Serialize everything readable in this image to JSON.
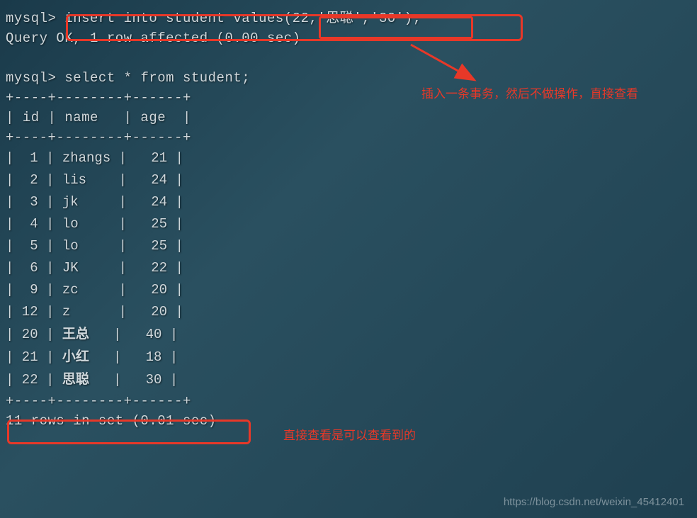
{
  "terminal": {
    "prompt": "mysql>",
    "cmd1": " insert into student values(22,'思聪','30');",
    "result1": "Query OK, 1 row affected (0.00 sec)",
    "cmd2": " select * from student;",
    "separator": "+----+--------+------+",
    "header": "| id | name   | age  |",
    "rows": [
      {
        "id": "1",
        "name": "zhangs",
        "age": "21"
      },
      {
        "id": "2",
        "name": "lis",
        "age": "24"
      },
      {
        "id": "3",
        "name": "jk",
        "age": "24"
      },
      {
        "id": "4",
        "name": "lo",
        "age": "25"
      },
      {
        "id": "5",
        "name": "lo",
        "age": "25"
      },
      {
        "id": "6",
        "name": "JK",
        "age": "22"
      },
      {
        "id": "9",
        "name": "zc",
        "age": "20"
      },
      {
        "id": "12",
        "name": "z",
        "age": "20"
      },
      {
        "id": "20",
        "name": "王总",
        "age": "40",
        "cjk": true
      },
      {
        "id": "21",
        "name": "小红",
        "age": "18",
        "cjk": true
      },
      {
        "id": "22",
        "name": "思聪",
        "age": "30",
        "cjk": true
      }
    ],
    "footer": "11 rows in set (0.01 sec)"
  },
  "annotations": {
    "a1": "插入一条事务，然后不做操作，直接查看",
    "a2": "直接查看是可以查看到的"
  },
  "watermark": "https://blog.csdn.net/weixin_45412401"
}
